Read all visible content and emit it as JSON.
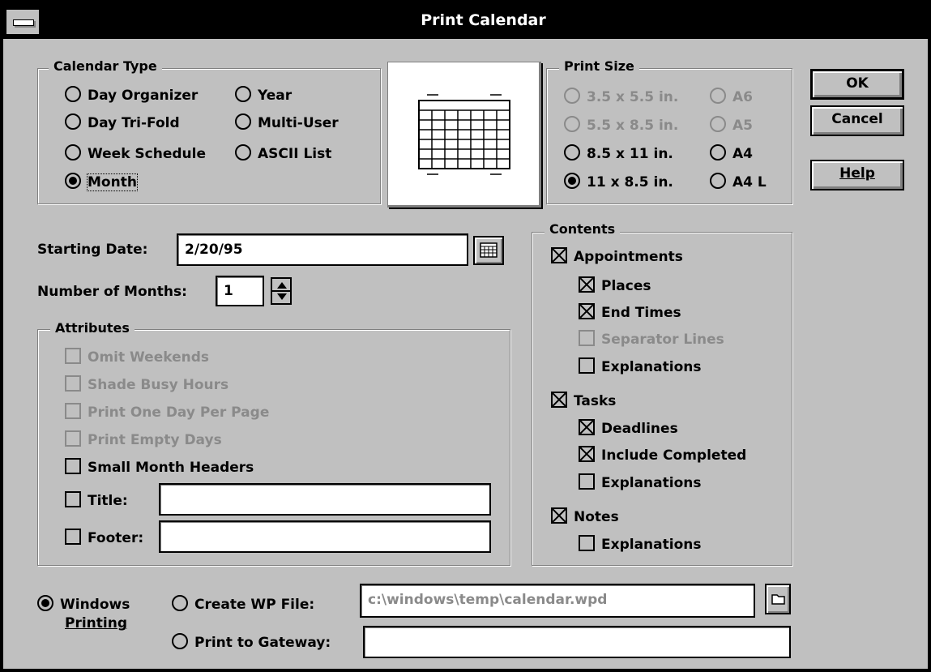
{
  "window": {
    "title": "Print Calendar"
  },
  "calendar_type": {
    "legend": "Calendar Type",
    "options": [
      {
        "label": "Day Organizer",
        "selected": false
      },
      {
        "label": "Day Tri-Fold",
        "selected": false
      },
      {
        "label": "Week Schedule",
        "selected": false
      },
      {
        "label": "Month",
        "selected": true
      },
      {
        "label": "Year",
        "selected": false
      },
      {
        "label": "Multi-User",
        "selected": false
      },
      {
        "label": "ASCII List",
        "selected": false
      }
    ]
  },
  "print_size": {
    "legend": "Print Size",
    "options": [
      {
        "label": "3.5 x 5.5 in.",
        "selected": false,
        "enabled": false
      },
      {
        "label": "A6",
        "selected": false,
        "enabled": false
      },
      {
        "label": "5.5 x 8.5 in.",
        "selected": false,
        "enabled": false
      },
      {
        "label": "A5",
        "selected": false,
        "enabled": false
      },
      {
        "label": "8.5 x 11 in.",
        "selected": false,
        "enabled": true
      },
      {
        "label": "A4",
        "selected": false,
        "enabled": true
      },
      {
        "label": "11 x 8.5 in.",
        "selected": true,
        "enabled": true
      },
      {
        "label": "A4 L",
        "selected": false,
        "enabled": true
      }
    ]
  },
  "buttons": {
    "ok": "OK",
    "cancel": "Cancel",
    "help": "Help"
  },
  "starting_date": {
    "label": "Starting Date:",
    "value": "2/20/95"
  },
  "number_of_months": {
    "label": "Number of Months:",
    "value": "1"
  },
  "attributes": {
    "legend": "Attributes",
    "items": [
      {
        "label": "Omit Weekends",
        "checked": false,
        "enabled": false
      },
      {
        "label": "Shade Busy Hours",
        "checked": false,
        "enabled": false
      },
      {
        "label": "Print One Day Per Page",
        "checked": false,
        "enabled": false
      },
      {
        "label": "Print Empty Days",
        "checked": false,
        "enabled": false
      },
      {
        "label": "Small Month Headers",
        "checked": false,
        "enabled": true
      }
    ],
    "title_label": "Title:",
    "title_value": "",
    "footer_label": "Footer:",
    "footer_value": ""
  },
  "contents": {
    "legend": "Contents",
    "items": [
      {
        "label": "Appointments",
        "checked": true,
        "enabled": true
      },
      {
        "label": "Places",
        "checked": true,
        "enabled": true
      },
      {
        "label": "End Times",
        "checked": true,
        "enabled": true
      },
      {
        "label": "Separator Lines",
        "checked": false,
        "enabled": false
      },
      {
        "label": "Explanations",
        "checked": false,
        "enabled": true
      },
      {
        "label": "Tasks",
        "checked": true,
        "enabled": true
      },
      {
        "label": "Deadlines",
        "checked": true,
        "enabled": true
      },
      {
        "label": "Include Completed",
        "checked": true,
        "enabled": true
      },
      {
        "label": "Explanations",
        "checked": false,
        "enabled": true
      },
      {
        "label": "Notes",
        "checked": true,
        "enabled": true
      },
      {
        "label": "Explanations",
        "checked": false,
        "enabled": true
      }
    ]
  },
  "output": {
    "windows_printing_line1": "Windows",
    "windows_printing_line2": "Printing",
    "create_wp_file": "Create WP File:",
    "wp_file_path": "c:\\windows\\temp\\calendar.wpd",
    "print_to_gateway": "Print to Gateway:",
    "gateway_value": "",
    "selected": "windows_printing"
  }
}
